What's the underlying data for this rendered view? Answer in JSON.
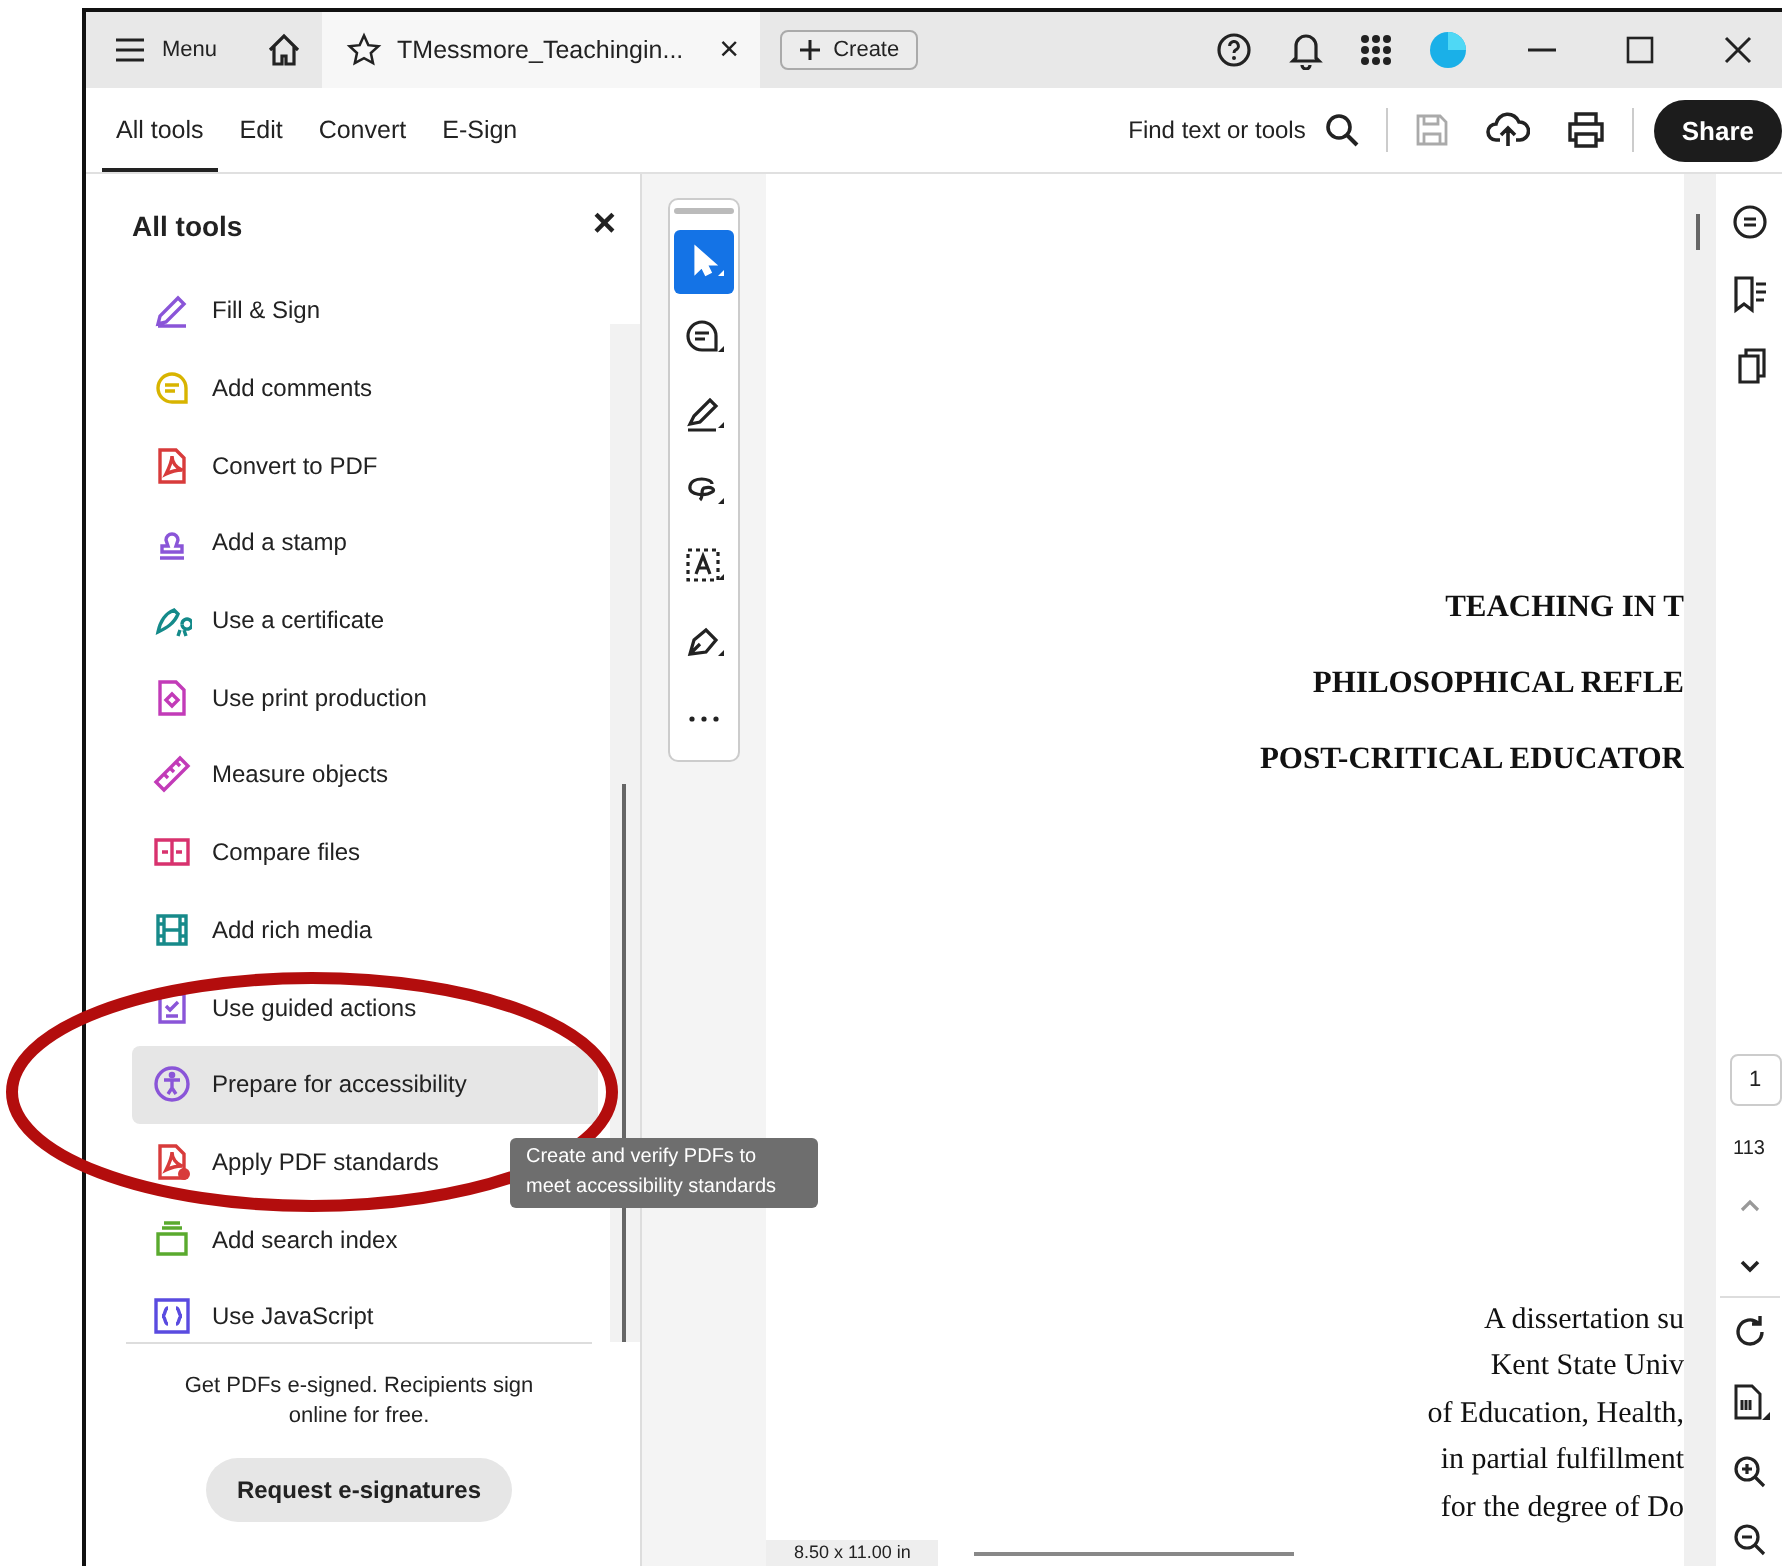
{
  "titlebar": {
    "menu_label": "Menu",
    "tab": {
      "title": "TMessmore_Teachingin...",
      "close": "×"
    },
    "create_label": "Create"
  },
  "toolbar": {
    "tabs": [
      {
        "label": "All tools",
        "selected": true
      },
      {
        "label": "Edit",
        "selected": false
      },
      {
        "label": "Convert",
        "selected": false
      },
      {
        "label": "E-Sign",
        "selected": false
      }
    ],
    "search_label": "Find text or tools",
    "save_disabled": true,
    "share_label": "Share"
  },
  "tools_panel": {
    "title": "All tools",
    "close": "×",
    "items": [
      {
        "label": "Fill & Sign",
        "kind": "sign",
        "color": "#8a55d8",
        "selected": false
      },
      {
        "label": "Add comments",
        "kind": "comment",
        "color": "#d8b400",
        "selected": false
      },
      {
        "label": "Convert to PDF",
        "kind": "pdf",
        "color": "#d83b3b",
        "selected": false
      },
      {
        "label": "Add a stamp",
        "kind": "stamp",
        "color": "#8a55d8",
        "selected": false
      },
      {
        "label": "Use a certificate",
        "kind": "certificate",
        "color": "#148a8a",
        "selected": false
      },
      {
        "label": "Use print production",
        "kind": "doc",
        "color": "#c23bb8",
        "selected": false
      },
      {
        "label": "Measure objects",
        "kind": "ruler",
        "color": "#c23bb8",
        "selected": false
      },
      {
        "label": "Compare files",
        "kind": "compare",
        "color": "#d8326e",
        "selected": false
      },
      {
        "label": "Add rich media",
        "kind": "media",
        "color": "#178a8a",
        "selected": false
      },
      {
        "label": "Use guided actions",
        "kind": "checklist",
        "color": "#8a55d8",
        "selected": false
      },
      {
        "label": "Prepare for accessibility",
        "kind": "accessibility",
        "color": "#8a55d8",
        "selected": true
      },
      {
        "label": "Apply PDF standards",
        "kind": "pdf-alert",
        "color": "#d83b3b",
        "selected": false
      },
      {
        "label": "Add search index",
        "kind": "index",
        "color": "#5aaa2e",
        "selected": false
      },
      {
        "label": "Use JavaScript",
        "kind": "code",
        "color": "#5a4be0",
        "selected": false
      }
    ],
    "promo": "Get PDFs e-signed. Recipients sign online for free.",
    "promo_button": "Request e-signatures"
  },
  "tooltip": "Create and verify PDFs to meet accessibility standards",
  "palette": [
    {
      "kind": "select",
      "selected": true
    },
    {
      "kind": "comment",
      "selected": false
    },
    {
      "kind": "highlight",
      "selected": false
    },
    {
      "kind": "lasso",
      "selected": false
    },
    {
      "kind": "text-box",
      "selected": false
    },
    {
      "kind": "pen",
      "selected": false
    },
    {
      "kind": "more",
      "selected": false
    }
  ],
  "document": {
    "title_lines": [
      "TEACHING IN T",
      "PHILOSOPHICAL REFLE",
      "POST-CRITICAL EDUCATOR"
    ],
    "body_lines": [
      "A dissertation su",
      "Kent State Univ",
      "of Education, Health,",
      "in partial fulfillment",
      "for the degree of Do"
    ],
    "page_size": "8.50 x 11.00 in"
  },
  "right_rail": {
    "page_number": "1",
    "page_count": "113"
  }
}
